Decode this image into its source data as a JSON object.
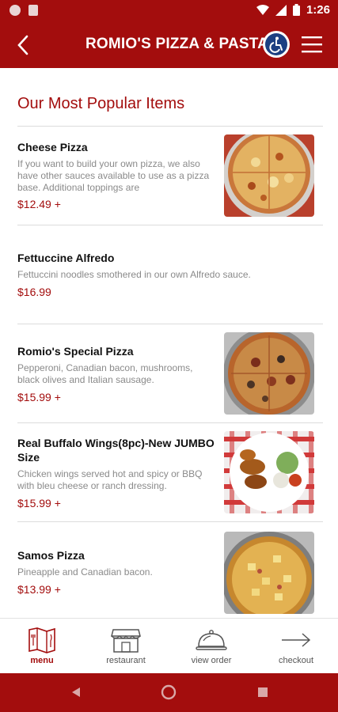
{
  "status_bar": {
    "time": "1:26"
  },
  "header": {
    "title": "ROMIO'S PIZZA & PASTA"
  },
  "section": {
    "title": "Our Most Popular Items"
  },
  "items": [
    {
      "name": "Cheese Pizza",
      "description": "If you want to build your own pizza, we also have other sauces available to use as a pizza base. Additional toppings are",
      "price": "$12.49 +"
    },
    {
      "name": "Fettuccine Alfredo",
      "description": "Fettuccini noodles smothered in our own Alfredo sauce.",
      "price": "$16.99"
    },
    {
      "name": "Romio's Special Pizza",
      "description": "Pepperoni, Canadian bacon, mushrooms, black olives and Italian sausage.",
      "price": "$15.99 +"
    },
    {
      "name": "Real Buffalo Wings(8pc)-New JUMBO Size",
      "description": "Chicken wings served hot and spicy or BBQ with bleu cheese or ranch dressing.",
      "price": "$15.99 +"
    },
    {
      "name": "Samos Pizza",
      "description": "Pineapple and Canadian bacon.",
      "price": "$13.99 +"
    }
  ],
  "bottom_nav": [
    {
      "label": "menu",
      "icon": "menu-book-icon",
      "active": true
    },
    {
      "label": "restaurant",
      "icon": "storefront-icon",
      "active": false
    },
    {
      "label": "view order",
      "icon": "cloche-icon",
      "active": false
    },
    {
      "label": "checkout",
      "icon": "arrow-right-icon",
      "active": false
    }
  ],
  "colors": {
    "brand": "#a30d0d",
    "accessibility_badge": "#1c3f82"
  }
}
